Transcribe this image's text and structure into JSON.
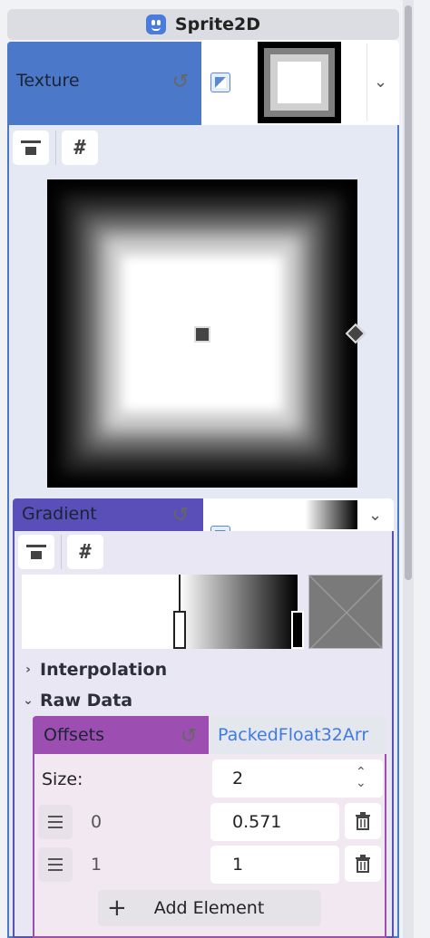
{
  "header": {
    "title": "Sprite2D",
    "icon": "sprite2d-icon"
  },
  "texture": {
    "label": "Texture",
    "reset_icon": "reset-icon",
    "resource_icon": "texture-resource-icon",
    "dropdown_icon": "chevron-down-icon"
  },
  "gradient": {
    "label": "Gradient",
    "reset_icon": "reset-icon",
    "dropdown_icon": "chevron-down-icon",
    "stop_offsets": [
      0.571,
      1
    ]
  },
  "sections": {
    "interpolation": "Interpolation",
    "raw_data": "Raw Data"
  },
  "offsets": {
    "label": "Offsets",
    "type_value": "PackedFloat32Arr",
    "size_label": "Size:",
    "size_value": "2",
    "rows": [
      {
        "index": "0",
        "value": "0.571"
      },
      {
        "index": "1",
        "value": "1"
      }
    ],
    "add_label": "Add Element"
  },
  "colors": {
    "texture_accent": "#4b78c8",
    "gradient_accent": "#5a4fb8",
    "offsets_accent": "#9c4fb0",
    "link_blue": "#3e7be0"
  }
}
